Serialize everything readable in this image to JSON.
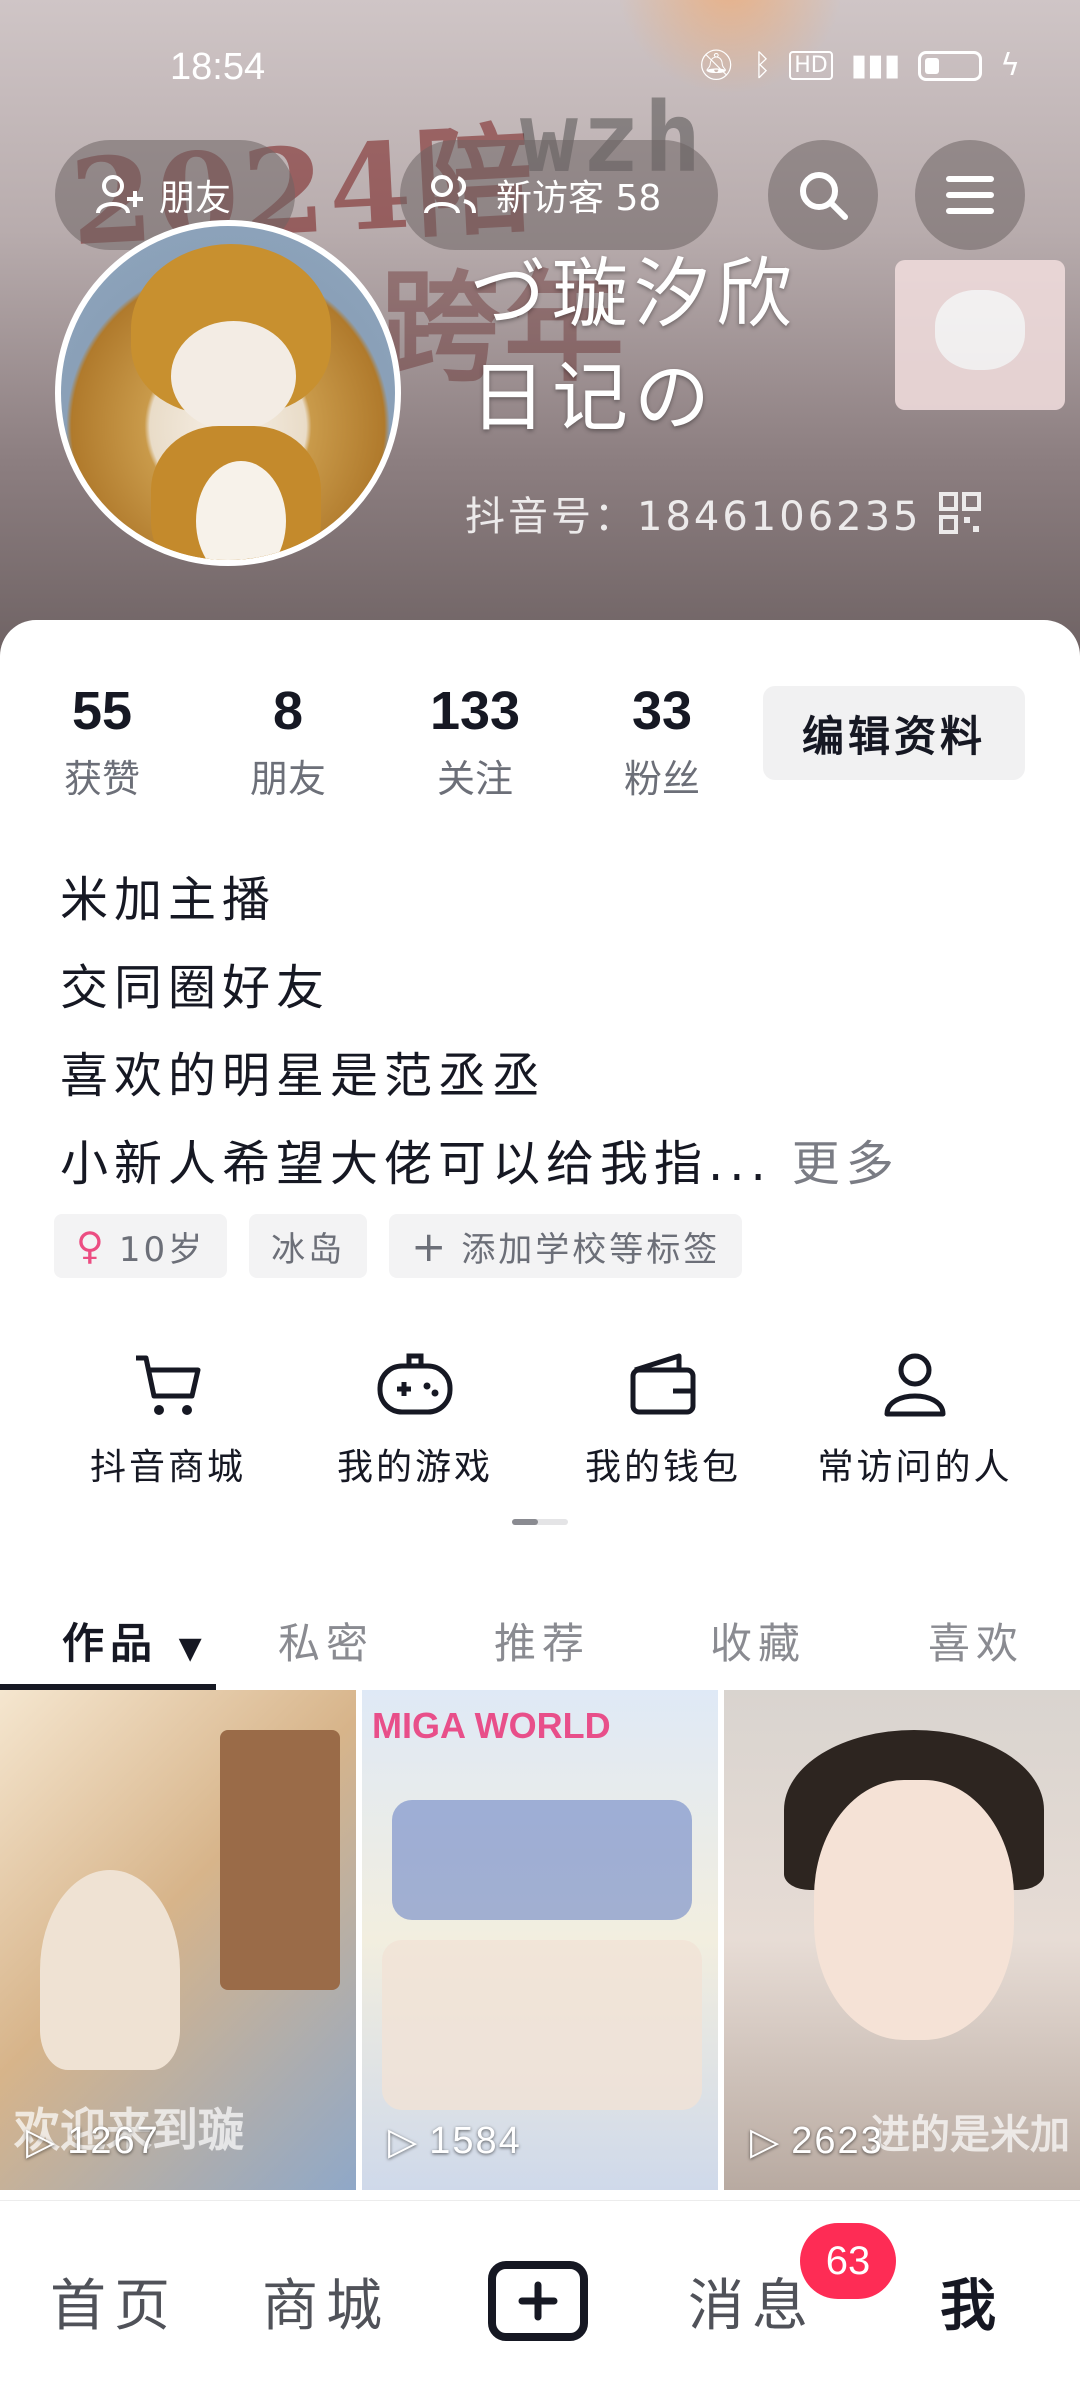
{
  "status_bar": {
    "time": "18:54",
    "icons": [
      "mute-icon",
      "bluetooth-icon",
      "hd-icon",
      "signal-5g-icon",
      "battery-icon",
      "charging-icon"
    ]
  },
  "header": {
    "friends_button": "朋友",
    "visitors_button": "新访客 58",
    "cover_deco_text_1": "2024陪",
    "cover_deco_text_2": "wzh",
    "cover_deco_text_3": "跨年"
  },
  "profile": {
    "nickname_line1": "づ璇汐欣",
    "nickname_line2": "日记の",
    "douyin_id": "抖音号：1846106235"
  },
  "stats": [
    {
      "value": "55",
      "label": "获赞"
    },
    {
      "value": "8",
      "label": "朋友"
    },
    {
      "value": "133",
      "label": "关注"
    },
    {
      "value": "33",
      "label": "粉丝"
    }
  ],
  "edit_button": "编辑资料",
  "bio": {
    "lines": [
      "米加主播",
      "交同圈好友",
      "喜欢的明星是范丞丞",
      "小新人希望大佬可以给我指..."
    ],
    "more": "更多"
  },
  "tags": {
    "age": "10岁",
    "location": "冰岛",
    "add_school": "添加学校等标签"
  },
  "shortcuts": [
    {
      "label": "抖音商城",
      "icon": "cart-icon"
    },
    {
      "label": "我的游戏",
      "icon": "gamepad-icon"
    },
    {
      "label": "我的钱包",
      "icon": "wallet-icon"
    },
    {
      "label": "常访问的人",
      "icon": "person-icon"
    }
  ],
  "tabs": [
    "作品",
    "私密",
    "推荐",
    "收藏",
    "喜欢"
  ],
  "videos": [
    {
      "plays": "1267",
      "overlay_text": "欢迎来到璇"
    },
    {
      "plays": "1584",
      "overlay_text": "MIGA WORLD"
    },
    {
      "plays": "2623",
      "overlay_text": "进的是米加"
    }
  ],
  "bottom_nav": {
    "home": "首页",
    "mall": "商城",
    "messages": "消息",
    "messages_badge": "63",
    "me": "我"
  },
  "colors": {
    "accent": "#fe2c55",
    "text_primary": "#161823",
    "text_secondary": "#6c6f78",
    "female_tag": "#ec4d82"
  }
}
